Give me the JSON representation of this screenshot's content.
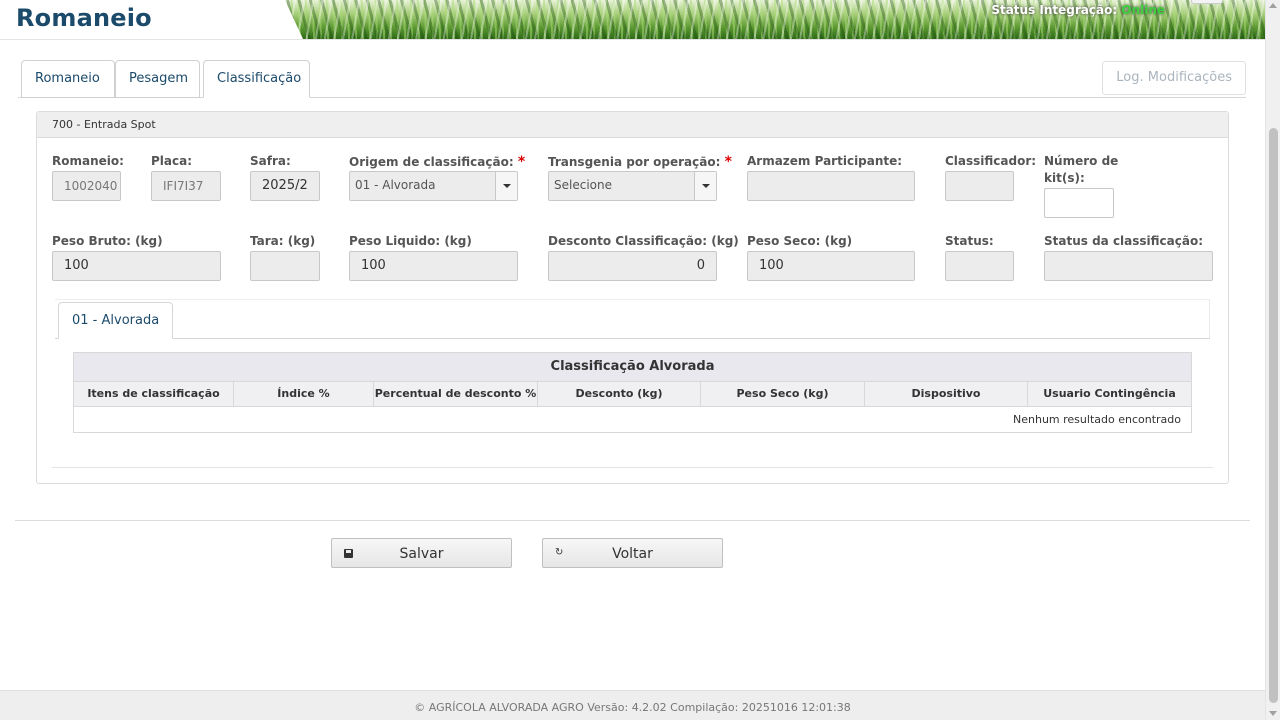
{
  "header": {
    "title": "Romaneio",
    "status_label": "Status Integração:",
    "status_value": "Online"
  },
  "main_tabs": {
    "romaneio": "Romaneio",
    "pesagem": "Pesagem",
    "classificacao": "Classificação",
    "log": "Log. Modificações",
    "active": "Classificação"
  },
  "panel": {
    "heading": "700 - Entrada Spot"
  },
  "form": {
    "romaneio": {
      "label": "Romaneio:",
      "value": "1002040"
    },
    "placa": {
      "label": "Placa:",
      "value": "IFI7I37"
    },
    "safra": {
      "label": "Safra:",
      "value": "2025/2"
    },
    "origem": {
      "label": "Origem de classificação:",
      "required": "*",
      "value": "01 - Alvorada"
    },
    "transgenia": {
      "label": "Transgenia por operação:",
      "required": "*",
      "value": "Selecione"
    },
    "armazem": {
      "label": "Armazem Participante:",
      "value": ""
    },
    "classificador": {
      "label": "Classificador:",
      "value": ""
    },
    "kits": {
      "label_line1": "Número de",
      "label_line2": "kit(s):",
      "value": ""
    },
    "peso_bruto": {
      "label": "Peso Bruto: (kg)",
      "value": "100"
    },
    "tara": {
      "label": "Tara: (kg)",
      "value": ""
    },
    "peso_liquido": {
      "label": "Peso Liquido: (kg)",
      "value": "100"
    },
    "desconto": {
      "label": "Desconto Classificação: (kg)",
      "value": "0"
    },
    "peso_seco": {
      "label": "Peso Seco: (kg)",
      "value": "100"
    },
    "status": {
      "label": "Status:",
      "value": ""
    },
    "status_classificacao": {
      "label": "Status da classificação:",
      "value": ""
    }
  },
  "inner_tabs": {
    "alvorada": "01 - Alvorada"
  },
  "classification_table": {
    "title": "Classificação Alvorada",
    "columns": [
      "Itens de classificação",
      "Índice %",
      "Percentual de desconto %",
      "Desconto (kg)",
      "Peso Seco (kg)",
      "Dispositivo",
      "Usuario Contingência"
    ],
    "empty_message": "Nenhum resultado encontrado"
  },
  "actions": {
    "save": "Salvar",
    "back": "Voltar"
  },
  "footer": {
    "text": "© AGRÍCOLA ALVORADA AGRO Versão: 4.2.02 Compilação: 20251016 12:01:38"
  },
  "colors": {
    "title_blue": "#1b4a6b",
    "online_green": "#3cd13c",
    "required_red": "#dd0000"
  }
}
